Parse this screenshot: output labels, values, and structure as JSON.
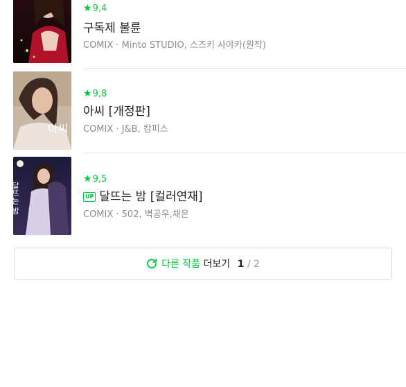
{
  "items": [
    {
      "rating": "9,4",
      "title": "구독제 불륜",
      "meta": "COMIX · Minto STUDIO, 스즈키 사야카(원작)",
      "badge": ""
    },
    {
      "rating": "9,8",
      "title": "아씨 [개정판]",
      "meta": "COMIX · J&B, 캄피스",
      "badge": "",
      "thumb_text": "아씨"
    },
    {
      "rating": "9,5",
      "title": "달뜨는 밤 [컬러연재]",
      "meta": "COMIX · 502, 벽공우,채은",
      "badge": "UP",
      "thumb_text": "달뜨는 밤"
    }
  ],
  "more": {
    "label_green": "다른 작품",
    "label_dark": "더보기",
    "page_current": "1",
    "page_separator": "/",
    "page_total": "2"
  },
  "colors": {
    "accent": "#00c73c",
    "title": "#222222",
    "meta": "#8c8c8c",
    "divider": "#ebebeb"
  }
}
